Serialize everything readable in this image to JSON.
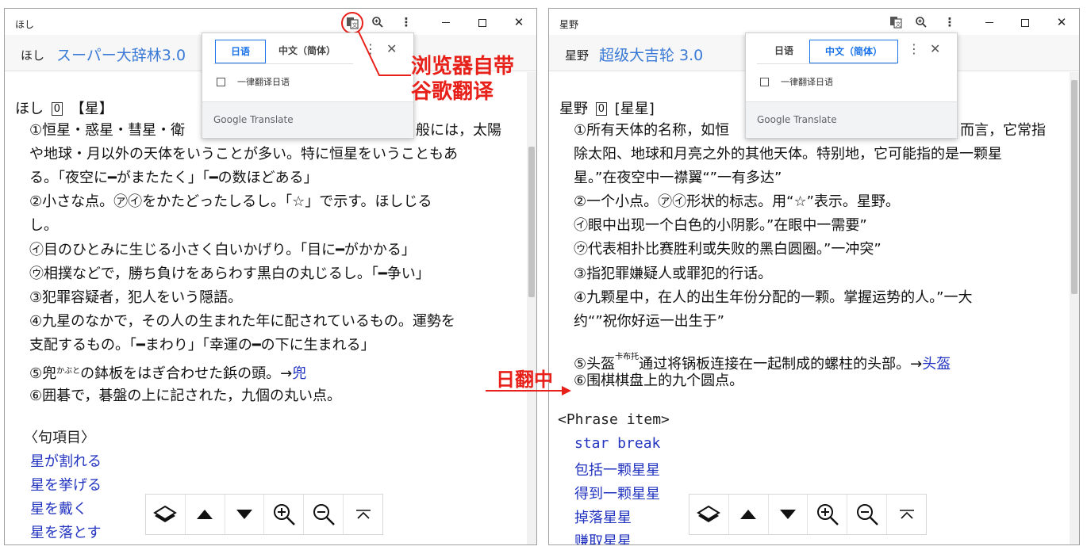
{
  "left_window": {
    "title": "ほし",
    "header_word": "ほし",
    "dict_name": "スーパー大辞林3.0",
    "entry_head": {
      "word": "ほし",
      "num": "0",
      "kanji": "【星】"
    },
    "lines": [
      "①恒星・惑星・彗星・衛",
      "般には，太陽",
      "や地球・月以外の天体をいうことが多い。特に恒星をいうこともあ",
      "る。「夜空に━がまたたく」「━の数ほどある」",
      "②小さな点。㋐㋑をかたどったしるし。「☆」で示す。ほしじる",
      "し。",
      "㋑目のひとみに生じる小さく白いかげり。「目に━がかかる」",
      "㋒相撲などで，勝ち負けをあらわす黒白の丸じるし。「━争い」",
      "③犯罪容疑者，犯人をいう隠語。",
      "④九星のなかで，その人の生まれた年に配されているもの。運勢を",
      "支配するもの。「━まわり」「幸運の━の下に生まれる」"
    ],
    "line5": {
      "pre": "⑤兜",
      "ruby": "かぶと",
      "mid": "の鉢板をはぎ合わせた鋲の頭。→",
      "link": "兜"
    },
    "line6": "⑥囲碁で，碁盤の上に記された，九個の丸い点。",
    "phrase_head": "〈句項目〉",
    "phrases": [
      "星が割れる",
      "星を挙げる",
      "星を戴く",
      "星を落とす"
    ]
  },
  "right_window": {
    "title": "星野",
    "header_word": "星野",
    "dict_name": "超级大吉轮 3.0",
    "entry_head": {
      "word": "星野",
      "num": "0",
      "kanji": "[星星]"
    },
    "lines": [
      "①所有天体的名称，如恒",
      "而言，它常指",
      "除太阳、地球和月亮之外的其他天体。特别地，它可能指的是一颗星",
      "星。”在夜空中一襟翼“”一有多达”",
      "②一个小点。㋐㋑形状的标志。用“☆”表示。星野。",
      "㋑眼中出现一个白色的小阴影。”在眼中一需要”",
      "㋒代表相扑比赛胜利或失败的黑白圆圈。”一冲突”",
      "③指犯罪嫌疑人或罪犯的行话。",
      "④九颗星中，在人的出生年份分配的一颗。掌握运势的人。”一大",
      "约“”祝你好运一出生于”"
    ],
    "line5": {
      "pre": "⑤头盔",
      "ruby": "卡布托",
      "mid": "通过将锅板连接在一起制成的螺柱的头部。→",
      "link": "头盔"
    },
    "line6": "⑥围棋棋盘上的九个圆点。",
    "phrase_head": "<Phrase item>",
    "phrases": [
      "star break",
      "包括一颗星星",
      "得到一颗星星",
      "掉落星星",
      "赚取星星"
    ]
  },
  "popup": {
    "tab_source": "日语",
    "tab_target": "中文（简体）",
    "checkbox_label": "一律翻译日语",
    "brand": "Google Translate",
    "more": "⋮",
    "close": "✕"
  },
  "annotations": {
    "browser_translate_line1": "浏览器自带",
    "browser_translate_line2": "谷歌翻译",
    "direction": "日翻中"
  },
  "colors": {
    "accent": "#1a73e8",
    "annotation": "#e8201a",
    "link": "#2234c0",
    "dict_title": "#3a7ad6"
  }
}
